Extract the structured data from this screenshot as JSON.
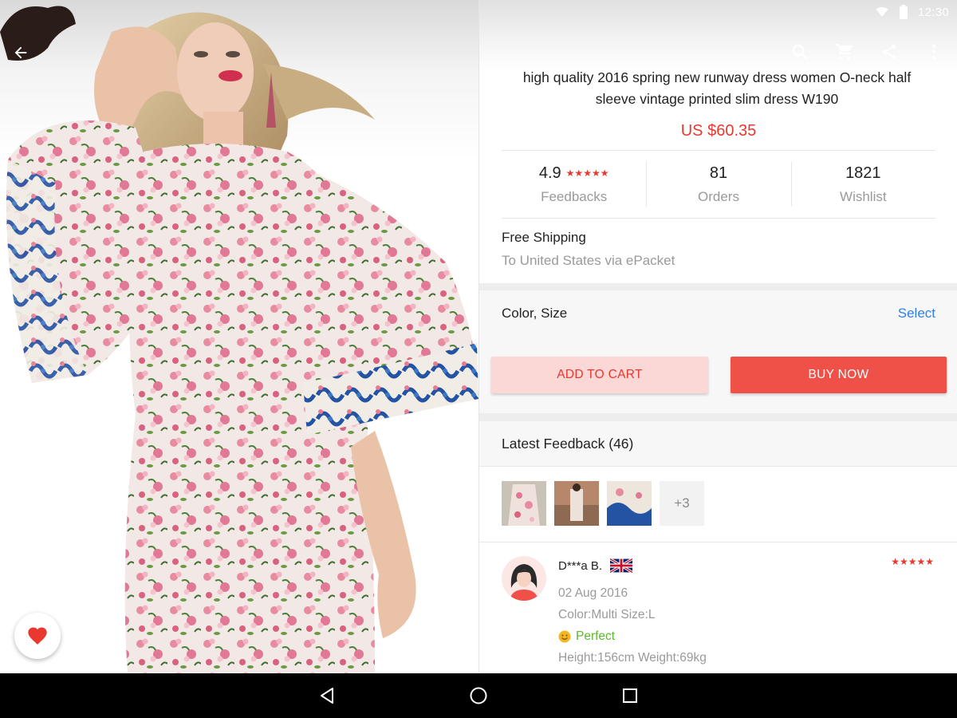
{
  "status_bar": {
    "time": "12:30"
  },
  "product": {
    "title": "high quality 2016 spring new runway dress women O-neck half sleeve vintage printed slim dress W190",
    "price": "US $60.35",
    "rating": "4.9",
    "rating_stars": "★★★★★",
    "stats": [
      {
        "value": "4.9",
        "label": "Feedbacks"
      },
      {
        "value": "81",
        "label": "Orders"
      },
      {
        "value": "1821",
        "label": "Wishlist"
      }
    ],
    "shipping": {
      "title": "Free Shipping",
      "detail": "To United States via ePacket"
    }
  },
  "options": {
    "label": "Color, Size",
    "action": "Select"
  },
  "buttons": {
    "add_to_cart": "ADD TO CART",
    "buy_now": "BUY NOW"
  },
  "feedback": {
    "header": "Latest Feedback (46)",
    "more_photos": "+3",
    "review": {
      "name": "D***a B.",
      "stars": "★★★★★",
      "date": "02 Aug 2016",
      "attributes": "Color:Multi Size:L",
      "sentiment": "Perfect",
      "body_info": "Height:156cm Weight:69kg"
    }
  },
  "colors": {
    "accent": "#e8382f",
    "link": "#2f7fe6",
    "positive": "#5cb82e"
  },
  "icons": [
    "back-arrow-icon",
    "search-icon",
    "cart-icon",
    "share-icon",
    "more-vert-icon",
    "heart-icon",
    "wifi-icon",
    "battery-icon",
    "nav-back-icon",
    "nav-home-icon",
    "nav-recents-icon",
    "uk-flag-icon",
    "smiley-icon"
  ]
}
